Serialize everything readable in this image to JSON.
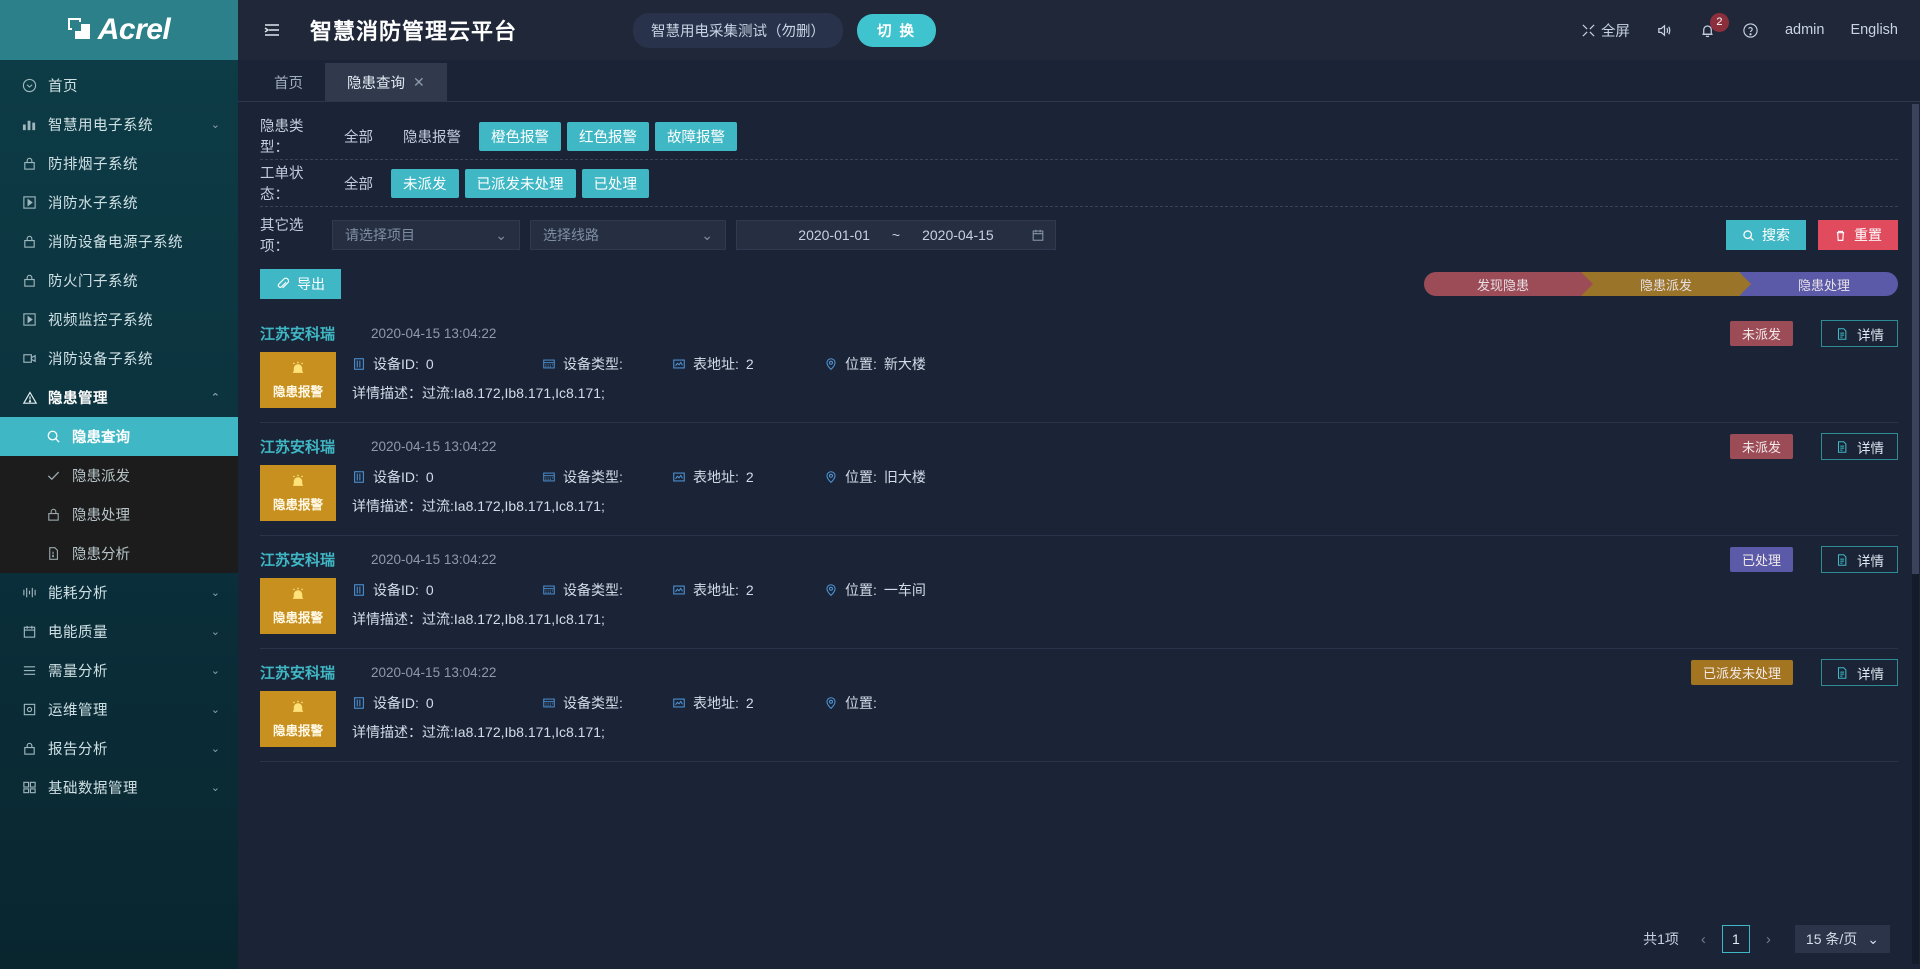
{
  "brand": {
    "name": "Acrel"
  },
  "sidebar": {
    "items": [
      {
        "label": "首页",
        "icon": "home-circle-icon",
        "expandable": false
      },
      {
        "label": "智慧用电子系统",
        "icon": "chart-bar-icon",
        "expandable": true
      },
      {
        "label": "防排烟子系统",
        "icon": "lock-icon",
        "expandable": false
      },
      {
        "label": "消防水子系统",
        "icon": "play-box-icon",
        "expandable": false
      },
      {
        "label": "消防设备电源子系统",
        "icon": "lock-icon",
        "expandable": false
      },
      {
        "label": "防火门子系统",
        "icon": "lock-icon",
        "expandable": false
      },
      {
        "label": "视频监控子系统",
        "icon": "play-box-icon",
        "expandable": false
      },
      {
        "label": "消防设备子系统",
        "icon": "video-icon",
        "expandable": false
      },
      {
        "label": "隐患管理",
        "icon": "warning-triangle-icon",
        "expandable": true,
        "expanded": true
      }
    ],
    "submenu": [
      {
        "label": "隐患查询",
        "icon": "search-icon",
        "active": true
      },
      {
        "label": "隐患派发",
        "icon": "check-icon",
        "active": false
      },
      {
        "label": "隐患处理",
        "icon": "lock-icon",
        "active": false
      },
      {
        "label": "隐患分析",
        "icon": "file-alert-icon",
        "active": false
      }
    ],
    "items_after": [
      {
        "label": "能耗分析",
        "icon": "signal-icon",
        "expandable": true
      },
      {
        "label": "电能质量",
        "icon": "calendar-icon",
        "expandable": true
      },
      {
        "label": "需量分析",
        "icon": "rows-icon",
        "expandable": true
      },
      {
        "label": "运维管理",
        "icon": "settings-box-icon",
        "expandable": true
      },
      {
        "label": "报告分析",
        "icon": "lock-icon",
        "expandable": true
      },
      {
        "label": "基础数据管理",
        "icon": "grid-icon",
        "expandable": true
      }
    ]
  },
  "header": {
    "menu_icon": "hamburger-icon",
    "title": "智慧消防管理云平台",
    "project_chip": "智慧用电采集测试（勿删）",
    "switch_button": "切 换",
    "fullscreen": "全屏",
    "sound_icon": "speaker-icon",
    "bell_icon": "bell-icon",
    "bell_count": "2",
    "help_icon": "question-circle-icon",
    "user": "admin",
    "language": "English"
  },
  "tabs": [
    {
      "label": "首页",
      "active": false,
      "closable": false
    },
    {
      "label": "隐患查询",
      "active": true,
      "closable": true,
      "close_icon": "close-icon"
    }
  ],
  "filters": {
    "type_label": "隐患类型：",
    "type_options": [
      {
        "label": "全部",
        "selected": false
      },
      {
        "label": "隐患报警",
        "selected": false
      },
      {
        "label": "橙色报警",
        "selected": true
      },
      {
        "label": "红色报警",
        "selected": true
      },
      {
        "label": "故障报警",
        "selected": true
      }
    ],
    "status_label": "工单状态：",
    "status_options": [
      {
        "label": "全部",
        "selected": false
      },
      {
        "label": "未派发",
        "selected": true
      },
      {
        "label": "已派发未处理",
        "selected": true
      },
      {
        "label": "已处理",
        "selected": true
      }
    ],
    "other_label": "其它选项：",
    "project_placeholder": "请选择项目",
    "line_placeholder": "选择线路",
    "date_start": "2020-01-01",
    "date_sep": "~",
    "date_end": "2020-04-15",
    "calendar_icon": "calendar-icon",
    "search_button": "搜索",
    "search_icon": "search-icon",
    "reset_button": "重置",
    "reset_icon": "trash-icon"
  },
  "toolbar": {
    "export_button": "导出",
    "export_icon": "paperclip-icon",
    "steps": [
      {
        "label": "发现隐患",
        "color": "#9c4c57"
      },
      {
        "label": "隐患派发",
        "color": "#9a7428"
      },
      {
        "label": "隐患处理",
        "color": "#5b5aa8"
      }
    ]
  },
  "records": [
    {
      "org": "江苏安科瑞",
      "time": "2020-04-15 13:04:22",
      "alarm_label": "隐患报警",
      "alarm_icon": "alarm-bell-icon",
      "device_id_label": "设备ID:",
      "device_id": "0",
      "device_type_label": "设备类型:",
      "device_type": "",
      "meter_label": "表地址:",
      "meter": "2",
      "location_label": "位置:",
      "location": "新大楼",
      "desc_label": "详情描述：",
      "desc": "过流:Ia8.172,Ib8.171,Ic8.171;",
      "status": "未派发",
      "status_class": "undispatched",
      "detail_button": "详情"
    },
    {
      "org": "江苏安科瑞",
      "time": "2020-04-15 13:04:22",
      "alarm_label": "隐患报警",
      "alarm_icon": "alarm-bell-icon",
      "device_id_label": "设备ID:",
      "device_id": "0",
      "device_type_label": "设备类型:",
      "device_type": "",
      "meter_label": "表地址:",
      "meter": "2",
      "location_label": "位置:",
      "location": "旧大楼",
      "desc_label": "详情描述：",
      "desc": "过流:Ia8.172,Ib8.171,Ic8.171;",
      "status": "未派发",
      "status_class": "undispatched",
      "detail_button": "详情"
    },
    {
      "org": "江苏安科瑞",
      "time": "2020-04-15 13:04:22",
      "alarm_label": "隐患报警",
      "alarm_icon": "alarm-bell-icon",
      "device_id_label": "设备ID:",
      "device_id": "0",
      "device_type_label": "设备类型:",
      "device_type": "",
      "meter_label": "表地址:",
      "meter": "2",
      "location_label": "位置:",
      "location": "一车间",
      "desc_label": "详情描述：",
      "desc": "过流:Ia8.172,Ib8.171,Ic8.171;",
      "status": "已处理",
      "status_class": "handled",
      "detail_button": "详情"
    },
    {
      "org": "江苏安科瑞",
      "time": "2020-04-15 13:04:22",
      "alarm_label": "隐患报警",
      "alarm_icon": "alarm-bell-icon",
      "device_id_label": "设备ID:",
      "device_id": "0",
      "device_type_label": "设备类型:",
      "device_type": "",
      "meter_label": "表地址:",
      "meter": "2",
      "location_label": "位置:",
      "location": "",
      "desc_label": "详情描述：",
      "desc": "过流:Ia8.172,Ib8.171,Ic8.171;",
      "status": "已派发未处理",
      "status_class": "dispatched",
      "detail_button": "详情"
    }
  ],
  "pagination": {
    "total": "共1项",
    "prev_icon": "chevron-left-icon",
    "page": "1",
    "next_icon": "chevron-right-icon",
    "page_size": "15 条/页",
    "page_size_icon": "chevron-down-icon"
  },
  "colors": {
    "accent": "#3fb7c4",
    "sidebar": "#0d3d47",
    "logo_bg": "#2b8089",
    "danger": "#e14b5e",
    "alarm": "#c8901f",
    "purple": "#5b5aa8"
  }
}
